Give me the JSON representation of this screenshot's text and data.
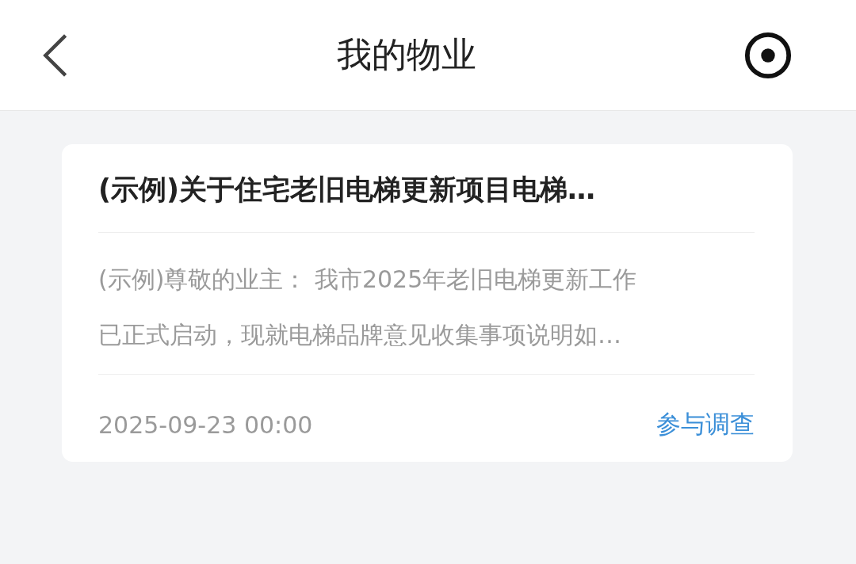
{
  "header": {
    "title": "我的物业"
  },
  "notice": {
    "title": "(示例)关于住宅老旧电梯更新项目电梯…",
    "body_lines": [
      "(示例)尊敬的业主：  我市2025年老旧电梯更新工作",
      "已正式启动，现就电梯品牌意见收集事项说明如…"
    ],
    "date": "2025-09-23 00:00",
    "action": "参与调查"
  }
}
